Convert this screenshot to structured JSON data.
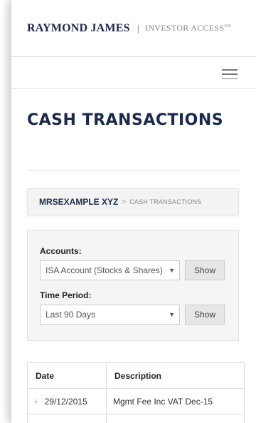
{
  "header": {
    "brand": "RAYMOND JAMES",
    "separator": "|",
    "product": "INVESTOR ACCESS",
    "trademark": "SM"
  },
  "page": {
    "title": "CASH TRANSACTIONS"
  },
  "breadcrumb": {
    "user": "MRSEXAMPLE XYZ",
    "arrow": ">",
    "current": "CASH TRANSACTIONS"
  },
  "filters": {
    "accounts_label": "Accounts:",
    "accounts_value": "ISA Account (Stocks & Shares)",
    "accounts_show": "Show",
    "period_label": "Time Period:",
    "period_value": "Last 90 Days",
    "period_show": "Show"
  },
  "table": {
    "headers": [
      "Date",
      "Description"
    ],
    "rows": [
      {
        "date": "29/12/2015",
        "description": "Mgmt Fee Inc VAT Dec-15"
      }
    ]
  },
  "icons": {
    "hamburger": "menu-icon",
    "caret": "caret-down-icon",
    "expand": "plus-icon"
  }
}
